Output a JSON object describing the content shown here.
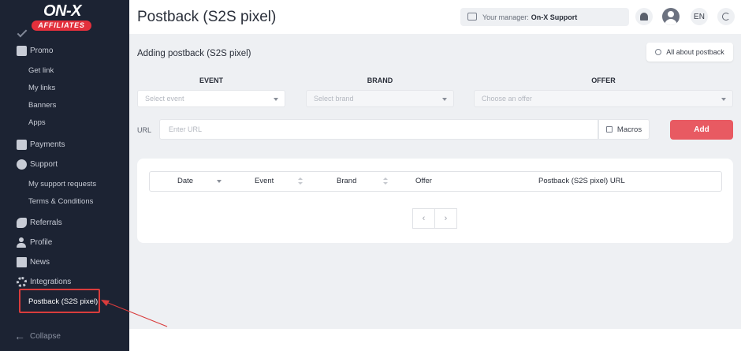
{
  "brand": {
    "logo_main": "ON-X",
    "logo_sub": "AFFILIATES",
    "accent": "#e3303c"
  },
  "sidebar": {
    "items": [
      {
        "label": "Promo",
        "icon": "promo-icon"
      },
      {
        "label": "Payments",
        "icon": "wallet-icon"
      },
      {
        "label": "Support",
        "icon": "support-icon"
      },
      {
        "label": "Referrals",
        "icon": "handshake-icon"
      },
      {
        "label": "Profile",
        "icon": "person-icon"
      },
      {
        "label": "News",
        "icon": "news-icon"
      },
      {
        "label": "Integrations",
        "icon": "gear-icon"
      }
    ],
    "promo_sub": [
      "Get link",
      "My links",
      "Banners",
      "Apps"
    ],
    "support_sub": [
      "My support requests",
      "Terms & Conditions"
    ],
    "integrations_sub": [
      "Postback (S2S pixel)"
    ],
    "collapse_label": "Collapse"
  },
  "header": {
    "title": "Postback (S2S pixel)",
    "manager_prefix": "Your manager:",
    "manager_name": "On-X Support",
    "language": "EN"
  },
  "main": {
    "section_title": "Adding postback (S2S pixel)",
    "about_button": "All about postback",
    "columns": {
      "event": {
        "label": "EVENT",
        "placeholder": "Select event"
      },
      "brand": {
        "label": "BRAND",
        "placeholder": "Select brand"
      },
      "offer": {
        "label": "OFFER",
        "placeholder": "Choose an offer"
      }
    },
    "url": {
      "label": "URL",
      "placeholder": "Enter URL"
    },
    "macros_button": "Macros",
    "add_button": "Add",
    "table": {
      "headers": [
        "Date",
        "Event",
        "Brand",
        "Offer",
        "Postback (S2S pixel) URL"
      ]
    },
    "pager": {
      "prev": "‹",
      "next": "›"
    }
  }
}
